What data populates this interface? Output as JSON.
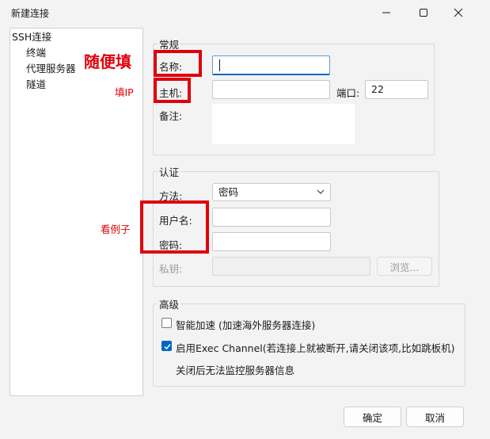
{
  "window": {
    "title": "新建连接",
    "min_icon": "minimize-icon",
    "max_icon": "maximize-icon",
    "close_icon": "close-icon"
  },
  "tree": {
    "items": [
      {
        "label": "SSH连接",
        "selected": true
      },
      {
        "label": "终端"
      },
      {
        "label": "代理服务器"
      },
      {
        "label": "隧道"
      }
    ]
  },
  "general": {
    "legend": "常规",
    "name_label": "名称:",
    "name_value": "",
    "host_label": "主机:",
    "host_value": "",
    "port_label": "端口:",
    "port_value": "22",
    "note_label": "备注:",
    "note_value": ""
  },
  "auth": {
    "legend": "认证",
    "method_label": "方法:",
    "method_value": "密码",
    "username_label": "用户名:",
    "username_value": "",
    "password_label": "密码:",
    "password_value": "",
    "key_label": "私钥:",
    "key_value": "",
    "browse_label": "浏览..."
  },
  "advanced": {
    "legend": "高级",
    "accel_label": "智能加速 (加速海外服务器连接)",
    "accel_checked": false,
    "exec_label": "启用Exec Channel(若连接上就被断开,请关闭该项,比如跳板机)",
    "exec_checked": true,
    "exec_note": "关闭后无法监控服务器信息"
  },
  "footer": {
    "ok_label": "确定",
    "cancel_label": "取消"
  },
  "annotations": {
    "name_hint": "随便填",
    "host_hint": "填IP",
    "cred_hint": "看例子",
    "color": "#e0000b"
  }
}
